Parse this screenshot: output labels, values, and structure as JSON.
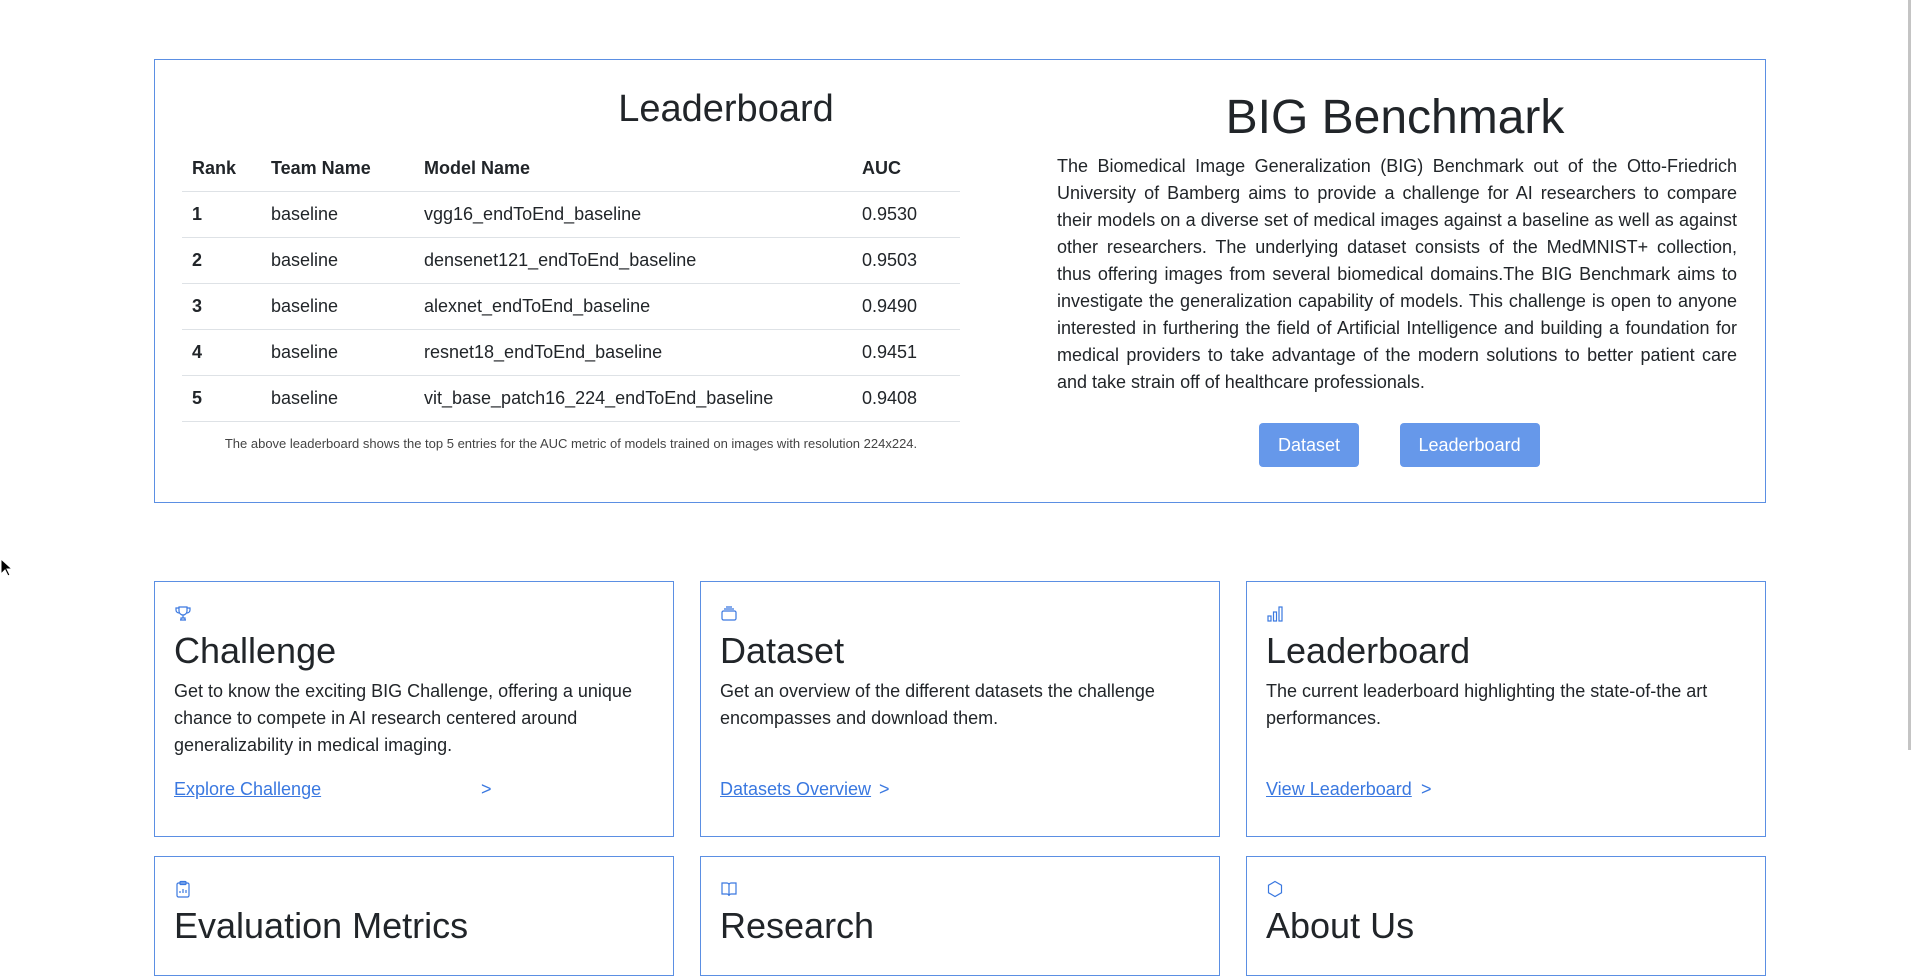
{
  "leaderboard": {
    "title": "Leaderboard",
    "columns": [
      "Rank",
      "Team Name",
      "Model Name",
      "AUC"
    ],
    "rows": [
      {
        "rank": "1",
        "team": "baseline",
        "model": "vgg16_endToEnd_baseline",
        "auc": "0.9530"
      },
      {
        "rank": "2",
        "team": "baseline",
        "model": "densenet121_endToEnd_baseline",
        "auc": "0.9503"
      },
      {
        "rank": "3",
        "team": "baseline",
        "model": "alexnet_endToEnd_baseline",
        "auc": "0.9490"
      },
      {
        "rank": "4",
        "team": "baseline",
        "model": "resnet18_endToEnd_baseline",
        "auc": "0.9451"
      },
      {
        "rank": "5",
        "team": "baseline",
        "model": "vit_base_patch16_224_endToEnd_baseline",
        "auc": "0.9408"
      }
    ],
    "note": "The above leaderboard shows the top 5 entries for the AUC metric of models trained on images with resolution 224x224."
  },
  "benchmark": {
    "title": "BIG Benchmark",
    "description": "The Biomedical Image Generalization (BIG) Benchmark out of the Otto-Friedrich University of Bamberg aims to provide a challenge for AI researchers to compare their models on a diverse set of medical images against a baseline as well as against other researchers. The underlying dataset consists of the MedMNIST+ collection, thus offering images from several biomedical domains.The BIG Benchmark aims to investigate the generalization capability of models. This challenge is open to anyone interested in furthering the field of Artificial Intelligence and building a foundation for medical providers to take advantage of the modern solutions to better patient care and take strain off of healthcare professionals.",
    "buttons": {
      "dataset": "Dataset",
      "leaderboard": "Leaderboard"
    }
  },
  "cards": [
    {
      "icon": "trophy-icon",
      "title": "Challenge",
      "text": "Get to know the exciting BIG Challenge, offering a unique chance to compete in AI research centered around generalizability in medical imaging.",
      "link": "Explore Challenge",
      "chevron": ">"
    },
    {
      "icon": "database-icon",
      "title": "Dataset",
      "text": "Get an overview of the different datasets the challenge encompasses and download them.",
      "link": "Datasets Overview",
      "chevron": ">"
    },
    {
      "icon": "bar-chart-icon",
      "title": "Leaderboard",
      "text": "The current leaderboard highlighting the state-of-the art performances.",
      "link": "View Leaderboard",
      "chevron": ">"
    },
    {
      "icon": "clipboard-icon",
      "title": "Evaluation Metrics"
    },
    {
      "icon": "book-icon",
      "title": "Research"
    },
    {
      "icon": "hexagon-icon",
      "title": "About Us"
    }
  ],
  "colors": {
    "accent": "#5b8fe3",
    "button": "#6698ea",
    "link": "#3a78e0"
  }
}
